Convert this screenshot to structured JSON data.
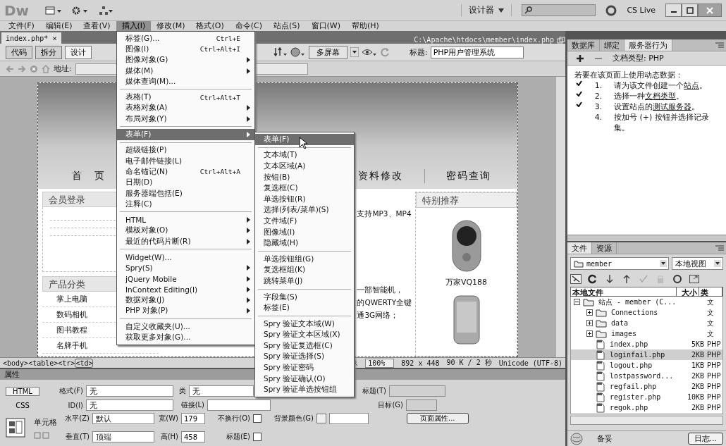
{
  "title_bar": {
    "logo": "Dw",
    "workspace": "设计器",
    "cs_live": "CS Live"
  },
  "menu_bar": [
    {
      "label": "文件(F)",
      "selected": false
    },
    {
      "label": "编辑(E)",
      "selected": false
    },
    {
      "label": "查看(V)",
      "selected": false
    },
    {
      "label": "插入(I)",
      "selected": true
    },
    {
      "label": "修改(M)",
      "selected": false
    },
    {
      "label": "格式(O)",
      "selected": false
    },
    {
      "label": "命令(C)",
      "selected": false
    },
    {
      "label": "站点(S)",
      "selected": false
    },
    {
      "label": "窗口(W)",
      "selected": false
    },
    {
      "label": "帮助(H)",
      "selected": false
    }
  ],
  "insert_menu": {
    "groups": [
      [
        {
          "label": "标签(G)...",
          "shortcut": "Ctrl+E",
          "submenu": false,
          "selected": false
        },
        {
          "label": "图像(I)",
          "shortcut": "Ctrl+Alt+I",
          "submenu": false,
          "selected": false
        },
        {
          "label": "图像对象(G)",
          "submenu": true,
          "selected": false
        },
        {
          "label": "媒体(M)",
          "submenu": true,
          "selected": false
        },
        {
          "label": "媒体查询(M)...",
          "submenu": false,
          "selected": false
        }
      ],
      [
        {
          "label": "表格(T)",
          "shortcut": "Ctrl+Alt+T",
          "submenu": false,
          "selected": false
        },
        {
          "label": "表格对象(A)",
          "submenu": true,
          "selected": false
        },
        {
          "label": "布局对象(Y)",
          "submenu": true,
          "selected": false
        }
      ],
      [
        {
          "label": "表单(F)",
          "submenu": true,
          "selected": true
        }
      ],
      [
        {
          "label": "超级链接(P)",
          "submenu": false,
          "selected": false
        },
        {
          "label": "电子邮件链接(L)",
          "submenu": false,
          "selected": false
        },
        {
          "label": "命名锚记(N)",
          "shortcut": "Ctrl+Alt+A",
          "submenu": false,
          "selected": false
        },
        {
          "label": "日期(D)",
          "submenu": false,
          "selected": false
        },
        {
          "label": "服务器端包括(E)",
          "submenu": false,
          "selected": false
        },
        {
          "label": "注释(C)",
          "submenu": false,
          "selected": false
        }
      ],
      [
        {
          "label": "HTML",
          "submenu": true,
          "selected": false
        },
        {
          "label": "模板对象(O)",
          "submenu": true,
          "selected": false
        },
        {
          "label": "最近的代码片断(R)",
          "submenu": true,
          "selected": false
        }
      ],
      [
        {
          "label": "Widget(W)...",
          "submenu": false,
          "selected": false
        },
        {
          "label": "Spry(S)",
          "submenu": true,
          "selected": false
        },
        {
          "label": "jQuery Mobile",
          "submenu": true,
          "selected": false
        },
        {
          "label": "InContext Editing(I)",
          "submenu": true,
          "selected": false
        },
        {
          "label": "数据对象(J)",
          "submenu": true,
          "selected": false
        },
        {
          "label": "PHP 对象(P)",
          "submenu": true,
          "selected": false
        }
      ],
      [
        {
          "label": "自定义收藏夹(U)...",
          "submenu": false,
          "selected": false
        },
        {
          "label": "获取更多对象(G)...",
          "submenu": false,
          "selected": false
        }
      ]
    ]
  },
  "form_submenu": {
    "groups": [
      [
        {
          "label": "表单(F)",
          "selected": true
        }
      ],
      [
        {
          "label": "文本域(T)",
          "selected": false
        },
        {
          "label": "文本区域(A)",
          "selected": false
        },
        {
          "label": "按钮(B)",
          "selected": false
        },
        {
          "label": "复选框(C)",
          "selected": false
        },
        {
          "label": "单选按钮(R)",
          "selected": false
        },
        {
          "label": "选择(列表/菜单)(S)",
          "selected": false
        },
        {
          "label": "文件域(F)",
          "selected": false
        },
        {
          "label": "图像域(I)",
          "selected": false
        },
        {
          "label": "隐藏域(H)",
          "selected": false
        }
      ],
      [
        {
          "label": "单选按钮组(G)",
          "selected": false
        },
        {
          "label": "复选框组(K)",
          "selected": false
        },
        {
          "label": "跳转菜单(J)",
          "selected": false
        }
      ],
      [
        {
          "label": "字段集(S)",
          "selected": false
        },
        {
          "label": "标签(E)",
          "selected": false
        }
      ],
      [
        {
          "label": "Spry 验证文本域(W)",
          "selected": false
        },
        {
          "label": "Spry 验证文本区域(X)",
          "selected": false
        },
        {
          "label": "Spry 验证复选框(C)",
          "selected": false
        },
        {
          "label": "Spry 验证选择(S)",
          "selected": false
        },
        {
          "label": "Spry 验证密码",
          "selected": false
        },
        {
          "label": "Spry 验证确认(O)",
          "selected": false
        },
        {
          "label": "Spry 验证单选按钮组",
          "selected": false
        }
      ]
    ]
  },
  "document": {
    "tab": {
      "label": "index.php*",
      "close": "×"
    },
    "path": "C:\\Apache\\htdocs\\member\\index.php",
    "view_buttons": [
      {
        "label": "代码",
        "selected": false
      },
      {
        "label": "拆分",
        "selected": false
      },
      {
        "label": "设计",
        "selected": true
      }
    ],
    "multiscreen": "多屏幕",
    "title_label": "标题:",
    "title_value": "PHP用户管理系统",
    "address_label": "地址:"
  },
  "page": {
    "nav": [
      "首　页",
      "资料修改",
      "密码查询"
    ],
    "login_title": "会员登录",
    "category_title": "产品分类",
    "categories": [
      "掌上电脑",
      "数码相机",
      "图书教程",
      "名牌手机"
    ],
    "news": [
      "支持MP3、MP4",
      "一部智能机，",
      "的QWERTY全键",
      "通3G网络；"
    ],
    "featured_title": "特别推荐",
    "featured_product": "万家VQ188"
  },
  "status_bar": {
    "tags": [
      {
        "label": "<body>",
        "selected": false
      },
      {
        "label": "<table>",
        "selected": false
      },
      {
        "label": "<tr>",
        "selected": false
      },
      {
        "label": "<td>",
        "selected": true
      }
    ],
    "zoom": "100%",
    "size": "892 x 448",
    "download": "90 K / 2 秒",
    "encoding": "Unicode (UTF-8)"
  },
  "properties": {
    "title": "属性",
    "modes": [
      {
        "label": "HTML",
        "selected": true
      },
      {
        "label": "CSS",
        "selected": false
      }
    ],
    "format_label": "格式(F)",
    "format_value": "无",
    "id_label": "ID(I)",
    "id_value": "无",
    "class_label": "类",
    "class_value": "无",
    "link_label": "链接(L)",
    "heading_label": "标题(T)",
    "target_label": "目标(G)",
    "cell_label": "单元格",
    "horz_label": "水平(Z)",
    "horz_value": "默认",
    "vert_label": "垂直(T)",
    "vert_value": "顶端",
    "width_label": "宽(W)",
    "width_value": "179",
    "height_label": "高(H)",
    "height_value": "458",
    "nowrap": {
      "label": "不换行(O)",
      "checked": false
    },
    "header": {
      "label": "标题(E)",
      "checked": false
    },
    "bg_label": "背景颜色(G)",
    "page_props": "页面属性..."
  },
  "server_panel": {
    "tabs": [
      {
        "label": "数据库",
        "selected": false
      },
      {
        "label": "绑定",
        "selected": false
      },
      {
        "label": "服务器行为",
        "selected": true
      }
    ],
    "doc_type": "文档类型: PHP",
    "intro": "若要在该页面上使用动态数据：",
    "steps": [
      {
        "number": "1.",
        "before": "请为该文件创建一个",
        "link": "站点",
        "after": "。",
        "done": true
      },
      {
        "number": "2.",
        "before": "选择一种",
        "link": "文档类型",
        "after": "。",
        "done": true
      },
      {
        "number": "3.",
        "before": "设置站点的",
        "link": "测试服务器",
        "after": "。",
        "done": true
      },
      {
        "number": "4.",
        "before": "按加号 (+) 按钮并选择记录集。",
        "done": false
      }
    ]
  },
  "files_panel": {
    "tabs": [
      {
        "label": "文件",
        "selected": true
      },
      {
        "label": "资源",
        "selected": false
      }
    ],
    "site": "member",
    "view": "本地视图",
    "columns": [
      "本地文件",
      "大小",
      "类"
    ],
    "tree": [
      {
        "kind": "site",
        "name": "站点 - member (C...",
        "type": "文",
        "expanded": true,
        "selected": false,
        "children": [
          {
            "kind": "folder",
            "name": "Connections",
            "type": "文",
            "expanded": false,
            "selected": false
          },
          {
            "kind": "folder",
            "name": "data",
            "type": "文",
            "expanded": false,
            "selected": false
          },
          {
            "kind": "folder",
            "name": "images",
            "type": "文",
            "expanded": false,
            "selected": false
          },
          {
            "kind": "file",
            "name": "index.php",
            "size": "5KB",
            "type": "PHP",
            "selected": false
          },
          {
            "kind": "file",
            "name": "loginfail.php",
            "size": "2KB",
            "type": "PHP",
            "selected": true
          },
          {
            "kind": "file",
            "name": "logout.php",
            "size": "1KB",
            "type": "PHP",
            "selected": false
          },
          {
            "kind": "file",
            "name": "lostpassword...",
            "size": "2KB",
            "type": "PHP",
            "selected": false
          },
          {
            "kind": "file",
            "name": "regfail.php",
            "size": "2KB",
            "type": "PHP",
            "selected": false
          },
          {
            "kind": "file",
            "name": "register.php",
            "size": "10KB",
            "type": "PHP",
            "selected": false
          },
          {
            "kind": "file",
            "name": "regok.php",
            "size": "2KB",
            "type": "PHP",
            "selected": false
          }
        ]
      }
    ],
    "status": "备妥",
    "log_button": "日志..."
  }
}
